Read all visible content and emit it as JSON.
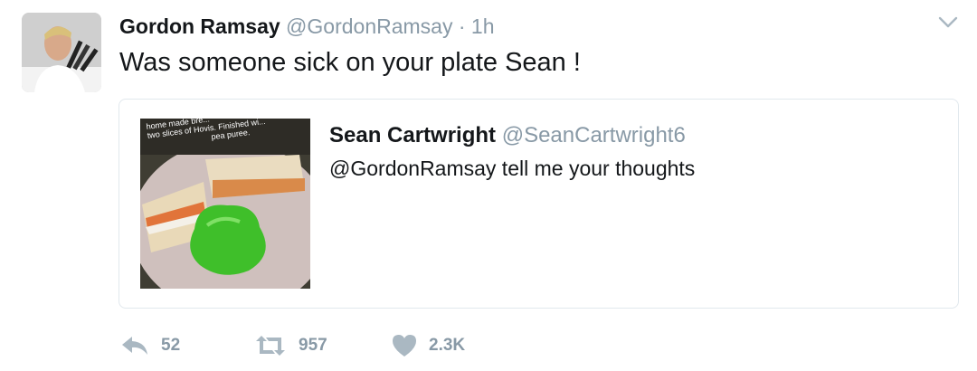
{
  "tweet": {
    "author_name": "Gordon Ramsay",
    "handle": "@GordonRamsay",
    "separator": "·",
    "time": "1h",
    "text": "Was someone sick on your plate Sean !"
  },
  "quoted_tweet": {
    "author_name": "Sean Cartwright",
    "handle": "@SeanCartwright6",
    "text": "@GordonRamsay tell me your thoughts",
    "image_caption_lines": [
      "home made bre...",
      "two slices of Hovis. Finished wi...",
      "pea puree."
    ]
  },
  "actions": {
    "reply_count": "52",
    "retweet_count": "957",
    "like_count": "2.3K"
  },
  "icons": {
    "reply": "reply-icon",
    "retweet": "retweet-icon",
    "like": "heart-icon",
    "menu": "chevron-down-icon"
  },
  "colors": {
    "muted": "#8899a6",
    "text": "#14171a",
    "border": "#e1e8ed",
    "pea_green": "#3fbf2a"
  }
}
